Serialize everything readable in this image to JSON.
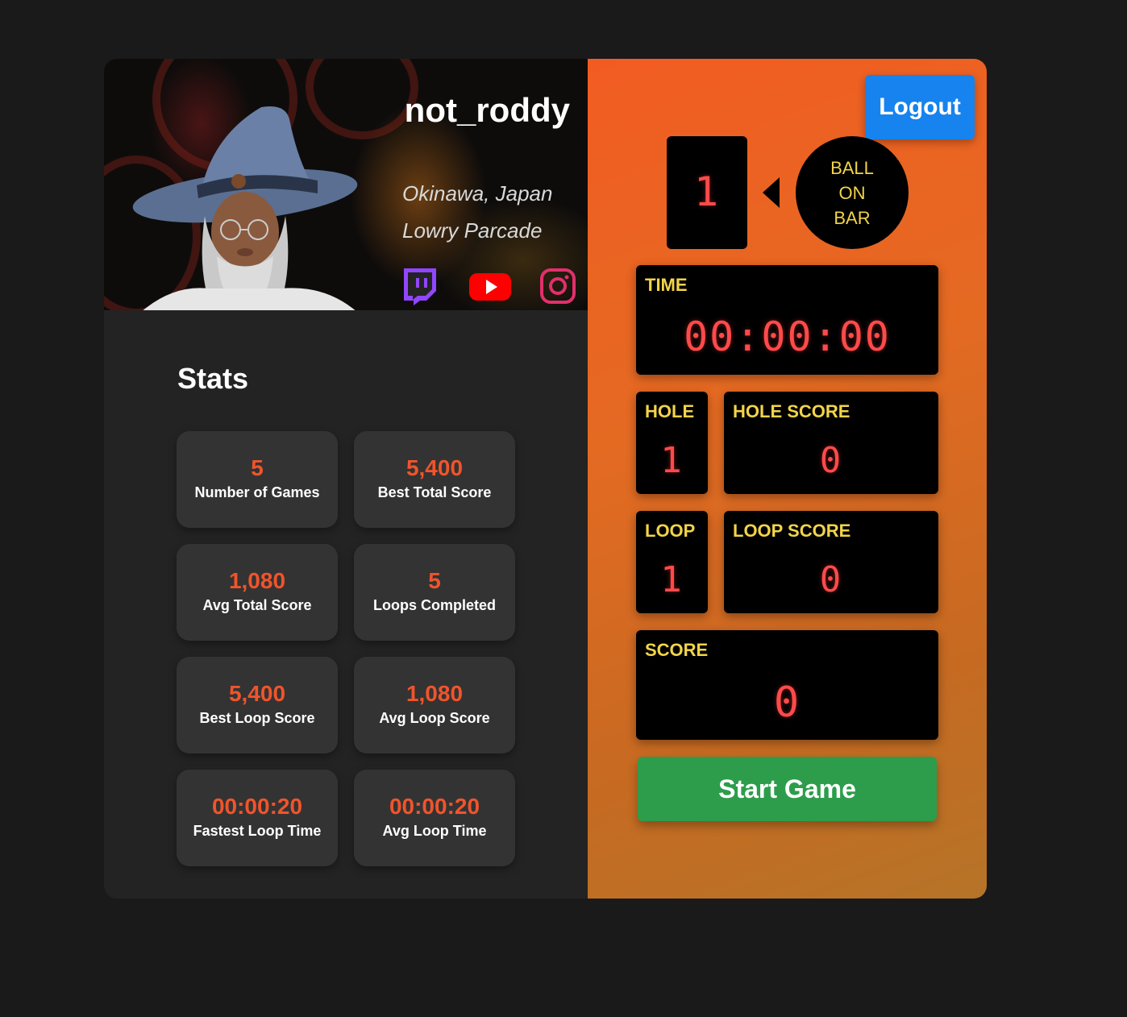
{
  "profile": {
    "username": "not_roddy",
    "location": "Okinawa, Japan",
    "arcade": "Lowry Parcade",
    "social": [
      "twitch-icon",
      "youtube-icon",
      "instagram-icon"
    ]
  },
  "stats": {
    "title": "Stats",
    "tiles": [
      {
        "value": "5",
        "label": "Number of Games"
      },
      {
        "value": "5,400",
        "label": "Best Total Score"
      },
      {
        "value": "1,080",
        "label": "Avg Total Score"
      },
      {
        "value": "5",
        "label": "Loops Completed"
      },
      {
        "value": "5,400",
        "label": "Best Loop Score"
      },
      {
        "value": "1,080",
        "label": "Avg Loop Score"
      },
      {
        "value": "00:00:20",
        "label": "Fastest Loop Time"
      },
      {
        "value": "00:00:20",
        "label": "Avg Loop Time"
      }
    ]
  },
  "game": {
    "logout_label": "Logout",
    "ball_number": "1",
    "ball_on_bar": [
      "BALL",
      "ON",
      "BAR"
    ],
    "time": {
      "label": "TIME",
      "value": "00:00:00"
    },
    "hole": {
      "label": "HOLE",
      "value": "1"
    },
    "hole_score": {
      "label": "HOLE SCORE",
      "value": "0"
    },
    "loop": {
      "label": "LOOP",
      "value": "1"
    },
    "loop_score": {
      "label": "LOOP SCORE",
      "value": "0"
    },
    "score": {
      "label": "SCORE",
      "value": "0"
    },
    "start_label": "Start Game"
  },
  "colors": {
    "accent_orange": "#f0542b",
    "segment_red": "#ff4a4a",
    "label_yellow": "#f2d44a",
    "logout_blue": "#1683ee",
    "start_green": "#2d9d4b"
  }
}
